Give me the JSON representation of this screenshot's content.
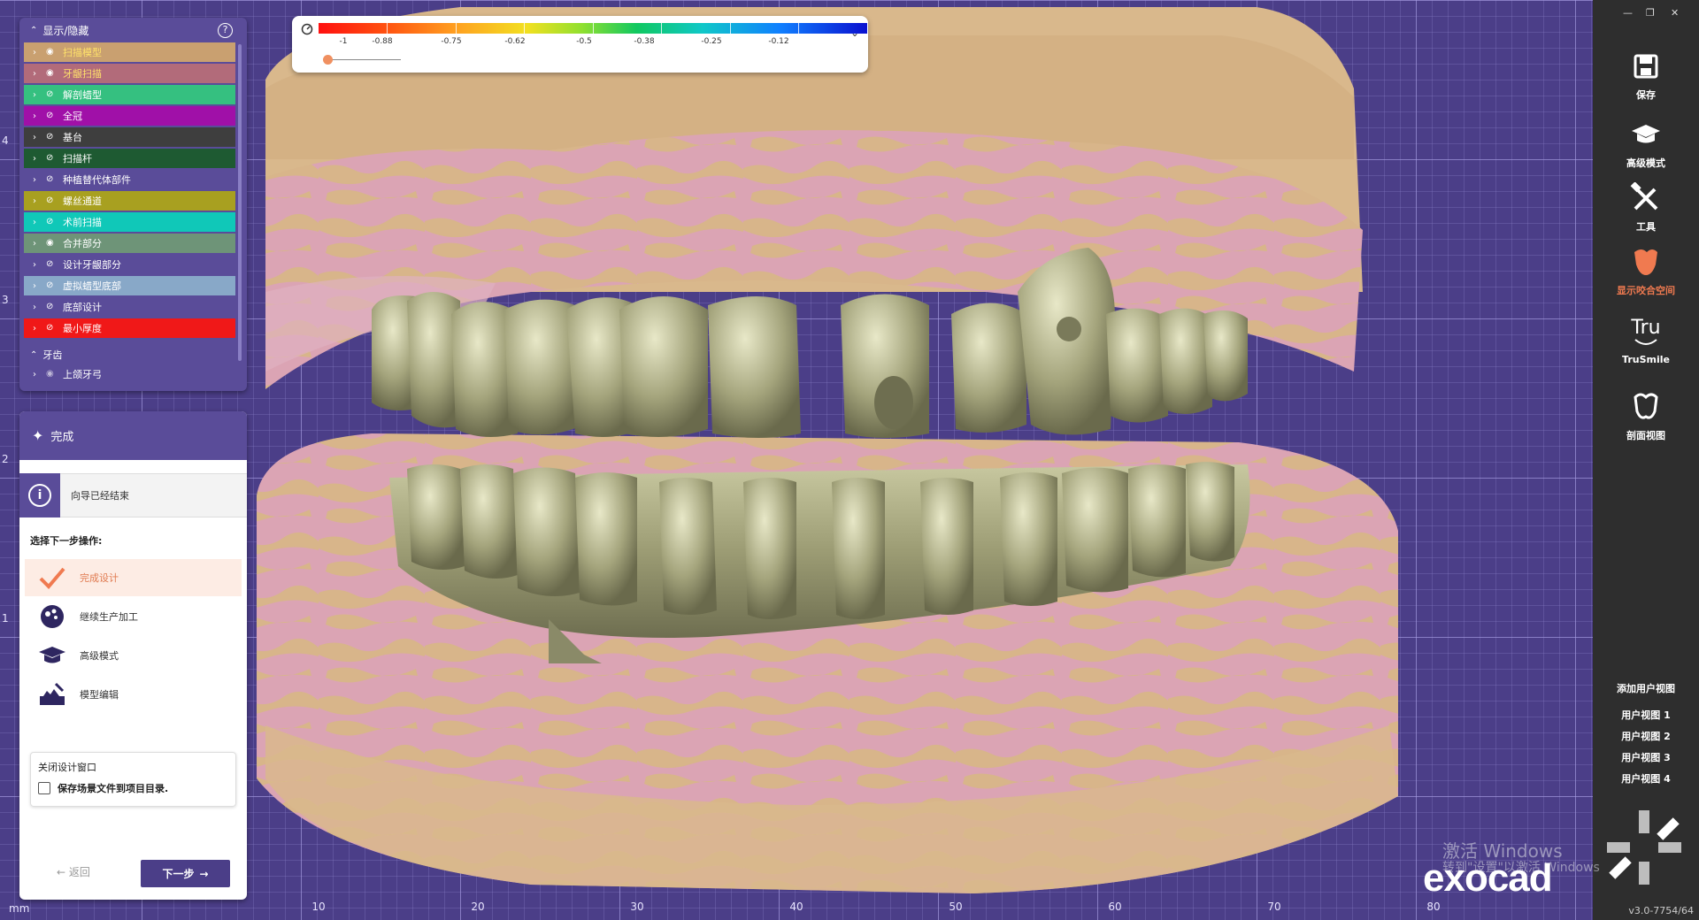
{
  "colorscale": {
    "ticks": [
      "-1",
      "-0.88",
      "-0.75",
      "-0.62",
      "-0.5",
      "-0.38",
      "-0.25",
      "-0.12"
    ]
  },
  "layers_panel": {
    "title": "显示/隐藏",
    "help": "?",
    "items": [
      {
        "label": "扫描模型",
        "color": "#c9a070",
        "text": "#ffe26a",
        "visible": true
      },
      {
        "label": "牙龈扫描",
        "color": "#b26b7a",
        "text": "#ffe26a",
        "visible": true
      },
      {
        "label": "解剖蜡型",
        "color": "#35c080",
        "text": "#ffffff",
        "visible": false
      },
      {
        "label": "全冠",
        "color": "#a010a8",
        "text": "#ffffff",
        "visible": false
      },
      {
        "label": "基台",
        "color": "#3e3e3e",
        "text": "#ffffff",
        "visible": false
      },
      {
        "label": "扫描杆",
        "color": "#1e5a32",
        "text": "#ffffff",
        "visible": false
      },
      {
        "label": "种植替代体部件",
        "color": "#5a4c99",
        "text": "#ffffff",
        "visible": false
      },
      {
        "label": "螺丝通道",
        "color": "#a8a020",
        "text": "#ffffff",
        "visible": false
      },
      {
        "label": "术前扫描",
        "color": "#10c8b8",
        "text": "#ffffff",
        "visible": false
      },
      {
        "label": "合并部分",
        "color": "#6e9478",
        "text": "#ffffff",
        "visible": true
      },
      {
        "label": "设计牙龈部分",
        "color": "#5a4c99",
        "text": "#ffffff",
        "visible": false
      },
      {
        "label": "虚拟蜡型底部",
        "color": "#88a8c8",
        "text": "#ffffff",
        "visible": false
      },
      {
        "label": "底部设计",
        "color": "#5a4c99",
        "text": "#ffffff",
        "visible": false
      },
      {
        "label": "最小厚度",
        "color": "#f01818",
        "text": "#ffffff",
        "visible": false
      }
    ],
    "group": "牙齿",
    "group_items": [
      {
        "label": "上颌牙弓",
        "visible": false
      }
    ]
  },
  "wizard": {
    "title": "完成",
    "info": "向导已经结束",
    "prompt": "选择下一步操作:",
    "actions": [
      {
        "label": "完成设计",
        "selected": true,
        "icon": "checkmark-icon"
      },
      {
        "label": "继续生产加工",
        "selected": false,
        "icon": "mill-icon"
      },
      {
        "label": "高级模式",
        "selected": false,
        "icon": "graduation-cap-icon"
      },
      {
        "label": "模型编辑",
        "selected": false,
        "icon": "model-edit-icon"
      }
    ],
    "close_title": "关闭设计窗口",
    "save_scene": "保存场景文件到项目目录.",
    "back": "返回",
    "next": "下一步"
  },
  "toolbar": {
    "tools": [
      {
        "label": "保存",
        "icon": "save-icon"
      },
      {
        "label": "高级模式",
        "icon": "graduation-cap-icon"
      },
      {
        "label": "工具",
        "icon": "tools-icon"
      },
      {
        "label": "显示咬合空间",
        "icon": "occlusion-icon",
        "active": true
      },
      {
        "label": "TruSmile",
        "icon": "trusmile-icon"
      },
      {
        "label": "剖面视图",
        "icon": "section-view-icon"
      }
    ],
    "add_view": "添加用户视图",
    "user_views": [
      "用户视图 1",
      "用户视图 2",
      "用户视图 3",
      "用户视图 4"
    ],
    "tru_text": "Tru"
  },
  "ruler": {
    "unit": "mm",
    "bottom": [
      "10",
      "20",
      "30",
      "40",
      "50",
      "60",
      "70",
      "80"
    ],
    "left": [
      "4",
      "3",
      "2",
      "1"
    ]
  },
  "branding": {
    "logo": "exocad",
    "version": "v3.0-7754/64",
    "watermark_line1": "激活 Windows",
    "watermark_line2": "转到\"设置\"以激活 Windows"
  },
  "colors": {
    "accent": "#f07a50",
    "panel": "#5a4c99",
    "toolbar": "#2e2e2e"
  }
}
